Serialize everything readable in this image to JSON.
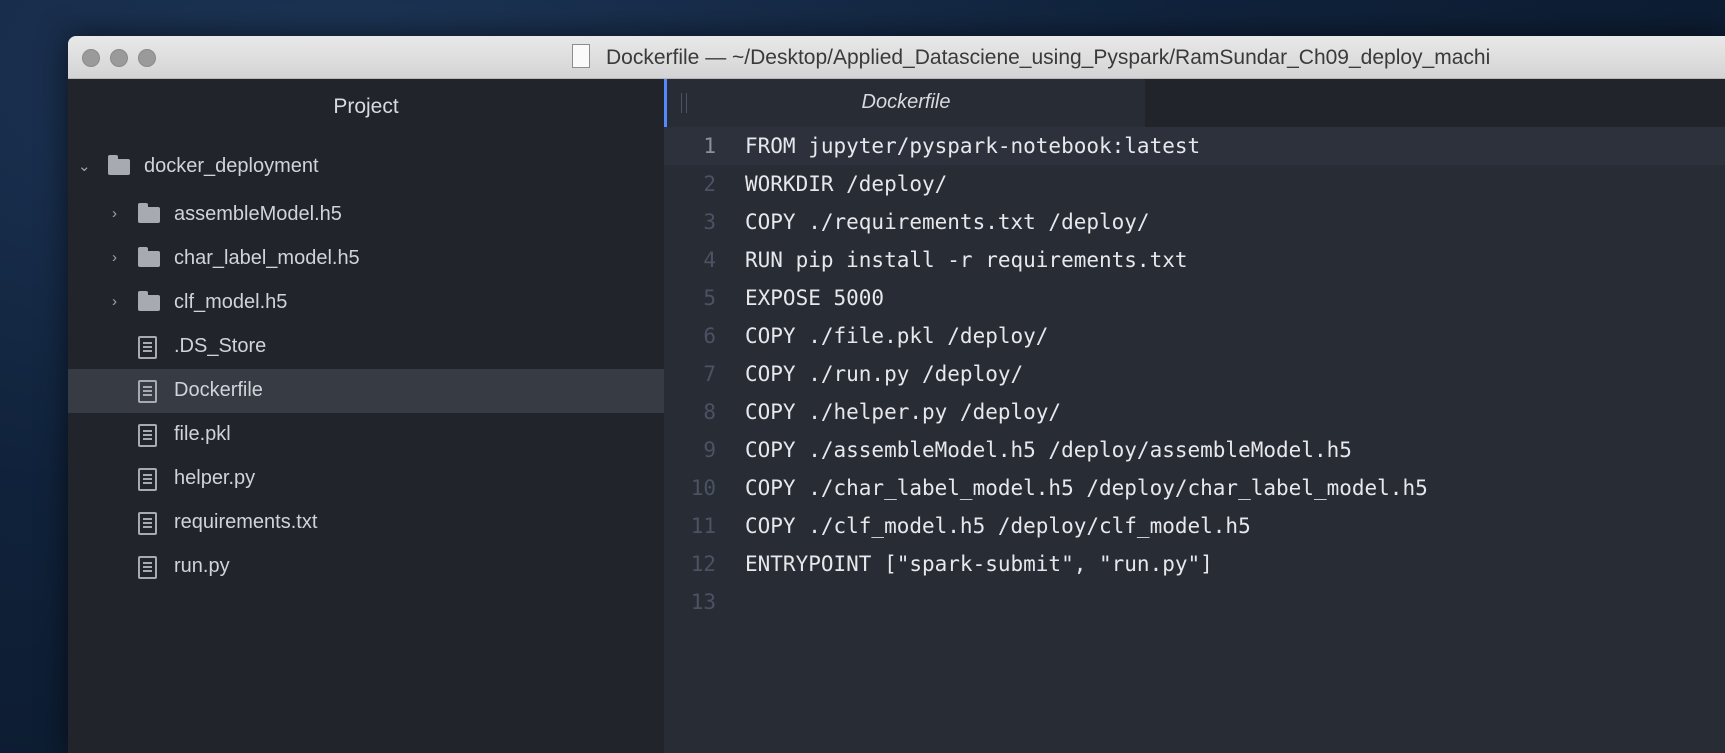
{
  "window": {
    "title": "Dockerfile — ~/Desktop/Applied_Datasciene_using_Pyspark/RamSundar_Ch09_deploy_machi"
  },
  "sidebar": {
    "header": "Project",
    "root": {
      "label": "docker_deployment",
      "icon": "folder-icon",
      "expanded": true
    },
    "items": [
      {
        "label": "assembleModel.h5",
        "type": "folder",
        "icon": "folder-icon"
      },
      {
        "label": "char_label_model.h5",
        "type": "folder",
        "icon": "folder-icon"
      },
      {
        "label": "clf_model.h5",
        "type": "folder",
        "icon": "folder-icon"
      },
      {
        "label": ".DS_Store",
        "type": "file",
        "icon": "file-icon"
      },
      {
        "label": "Dockerfile",
        "type": "file",
        "icon": "file-icon",
        "selected": true
      },
      {
        "label": "file.pkl",
        "type": "file",
        "icon": "file-icon"
      },
      {
        "label": "helper.py",
        "type": "file",
        "icon": "file-icon"
      },
      {
        "label": "requirements.txt",
        "type": "file",
        "icon": "file-icon"
      },
      {
        "label": "run.py",
        "type": "file",
        "icon": "file-icon"
      }
    ]
  },
  "editor": {
    "tab_title": "Dockerfile",
    "current_line": 1,
    "lines": [
      {
        "n": "1",
        "text": "FROM jupyter/pyspark-notebook:latest"
      },
      {
        "n": "2",
        "text": "WORKDIR /deploy/"
      },
      {
        "n": "3",
        "text": "COPY ./requirements.txt /deploy/"
      },
      {
        "n": "4",
        "text": "RUN pip install -r requirements.txt"
      },
      {
        "n": "5",
        "text": "EXPOSE 5000"
      },
      {
        "n": "6",
        "text": "COPY ./file.pkl /deploy/"
      },
      {
        "n": "7",
        "text": "COPY ./run.py /deploy/"
      },
      {
        "n": "8",
        "text": "COPY ./helper.py /deploy/"
      },
      {
        "n": "9",
        "text": "COPY ./assembleModel.h5 /deploy/assembleModel.h5"
      },
      {
        "n": "10",
        "text": "COPY ./char_label_model.h5 /deploy/char_label_model.h5"
      },
      {
        "n": "11",
        "text": "COPY ./clf_model.h5 /deploy/clf_model.h5"
      },
      {
        "n": "12",
        "text": "ENTRYPOINT [\"spark-submit\", \"run.py\"]"
      },
      {
        "n": "13",
        "text": ""
      }
    ]
  },
  "colors": {
    "accent": "#528bff",
    "sidebar_bg": "#21252b",
    "editor_bg": "#282c34",
    "selection": "#363b44"
  }
}
